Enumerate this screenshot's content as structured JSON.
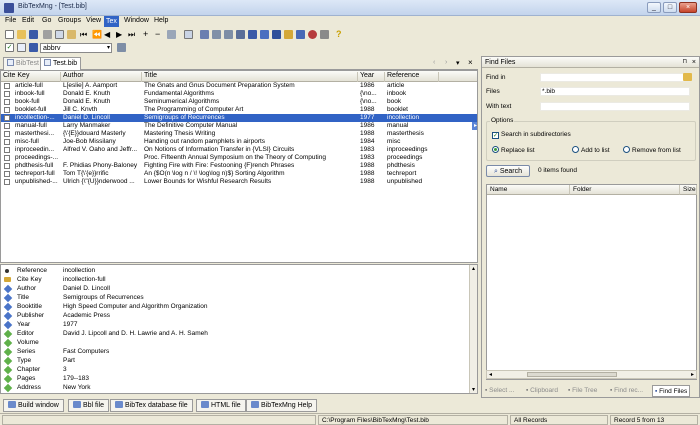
{
  "window": {
    "title": "BibTexMng - [Test.bib]",
    "buttons": [
      "_",
      "□",
      "×"
    ]
  },
  "menu": [
    "File",
    "Edit",
    "Go",
    "Groups",
    "View",
    "Tex",
    "Window",
    "Help"
  ],
  "menu_active": "Tex",
  "toolbar3": {
    "style_value": "abbrv"
  },
  "tabs": [
    {
      "label": "BibTest",
      "active": false
    },
    {
      "label": "Test.bib",
      "active": true
    }
  ],
  "tab_controls": [
    "‹",
    "›",
    "▾",
    "×"
  ],
  "columns": [
    "Cite Key",
    "Author",
    "Title",
    "Year",
    "Reference"
  ],
  "rows": [
    {
      "key": "article-full",
      "author": "L[eslie] A. Aamport",
      "title": "The Gnats and Gnus Document Preparation System",
      "year": "1986",
      "ref": "article"
    },
    {
      "key": "inbook-full",
      "author": "Donald E. Knuth",
      "title": "Fundamental Algorithms",
      "year": "{\\no...",
      "ref": "inbook"
    },
    {
      "key": "book-full",
      "author": "Donald E. Knuth",
      "title": "Seminumerical Algorithms",
      "year": "{\\no...",
      "ref": "book"
    },
    {
      "key": "booklet-full",
      "author": "Jill C. Knvth",
      "title": "The Programming of Computer Art",
      "year": "1988",
      "ref": "booklet"
    },
    {
      "key": "incollection-...",
      "author": "Daniel D. Lincoll",
      "title": "Semigroups of Recurrences",
      "year": "1977",
      "ref": "incollection",
      "selected": true
    },
    {
      "key": "manual-full",
      "author": "Larry Manmaker",
      "title": "The Definitive Computer Manual",
      "year": "1986",
      "ref": "manual"
    },
    {
      "key": "masterthesi...",
      "author": "{\\'{E}}douard Masterly",
      "title": "Mastering Thesis Writing",
      "year": "1988",
      "ref": "masterthesis"
    },
    {
      "key": "misc-full",
      "author": "Joe-Bob Missilany",
      "title": "Handing out random pamphlets in airports",
      "year": "1984",
      "ref": "misc"
    },
    {
      "key": "inproceedin...",
      "author": "Alfred V. Oaho and Jeffr...",
      "title": "On Notions of Information Transfer in {VLSI} Circuits",
      "year": "1983",
      "ref": "inproceedings"
    },
    {
      "key": "proceedings-...",
      "author": "",
      "title": "Proc. Fifteenth Annual Symposium on the Theory of  Computing",
      "year": "1983",
      "ref": "proceedings"
    },
    {
      "key": "phdthesis-full",
      "author": "F. Phidias Phony-Baloney",
      "title": "Fighting Fire with Fire: Festooning {F}rench Phrases",
      "year": "1988",
      "ref": "phdthesis"
    },
    {
      "key": "techreport-full",
      "author": "Tom T{\\'{e}}rrific",
      "title": "An {$O(n \\log n / \\! \\log\\log n)$} Sorting Algorithm",
      "year": "1988",
      "ref": "techreport"
    },
    {
      "key": "unpublished-...",
      "author": "Ulrich {\\\"{U}}nderwood ...",
      "title": "Lower Bounds for Wishful Research Results",
      "year": "1988",
      "ref": "unpublished"
    }
  ],
  "properties": [
    {
      "name": "Reference",
      "value": "incollection",
      "icon": "dot"
    },
    {
      "name": "Cite Key",
      "value": "incollection-full",
      "icon": "key"
    },
    {
      "name": "Author",
      "value": "Daniel D. Lincoll",
      "icon": "blue"
    },
    {
      "name": "Title",
      "value": "Semigroups of Recurrences",
      "icon": "blue"
    },
    {
      "name": "Booktitle",
      "value": "High Speed Computer and Algorithm Organization",
      "icon": "blue"
    },
    {
      "name": "Publisher",
      "value": "Academic Press",
      "icon": "blue"
    },
    {
      "name": "Year",
      "value": "1977",
      "icon": "blue"
    },
    {
      "name": "Editor",
      "value": "David J. Lipcoll and D. H. Lawrie and A. H. Sameh",
      "icon": "green"
    },
    {
      "name": "Volume",
      "value": "",
      "icon": "green"
    },
    {
      "name": "Series",
      "value": "Fast Computers",
      "icon": "green"
    },
    {
      "name": "Type",
      "value": "Part",
      "icon": "green"
    },
    {
      "name": "Chapter",
      "value": "3",
      "icon": "green"
    },
    {
      "name": "Pages",
      "value": "179--183",
      "icon": "green"
    },
    {
      "name": "Address",
      "value": "New York",
      "icon": "green"
    }
  ],
  "bottom_tabs": [
    "Build window",
    "Bbl file",
    "BibTex database file",
    "HTML file",
    "BibTexMng Help"
  ],
  "status": {
    "path": "C:\\Program Files\\BibTexMng\\Test.bib",
    "filter": "All Records",
    "record": "Record 5 from 13"
  },
  "find": {
    "title": "Find Files",
    "find_in_label": "Find in",
    "find_in_value": "",
    "files_label": "Files",
    "files_value": "*.bib",
    "with_text_label": "With text",
    "with_text_value": "",
    "options_label": "Options",
    "search_sub": "Search in subdirectories",
    "replace_list": "Replace list",
    "add_list": "Add to list",
    "remove_list": "Remove from list",
    "search_btn": "Search",
    "items_found": "0 items found",
    "cols": [
      "Name",
      "Folder",
      "Size"
    ],
    "bottom": [
      "Select ...",
      "Clipboard",
      "File Tree",
      "Find rec...",
      "Find Files"
    ]
  }
}
